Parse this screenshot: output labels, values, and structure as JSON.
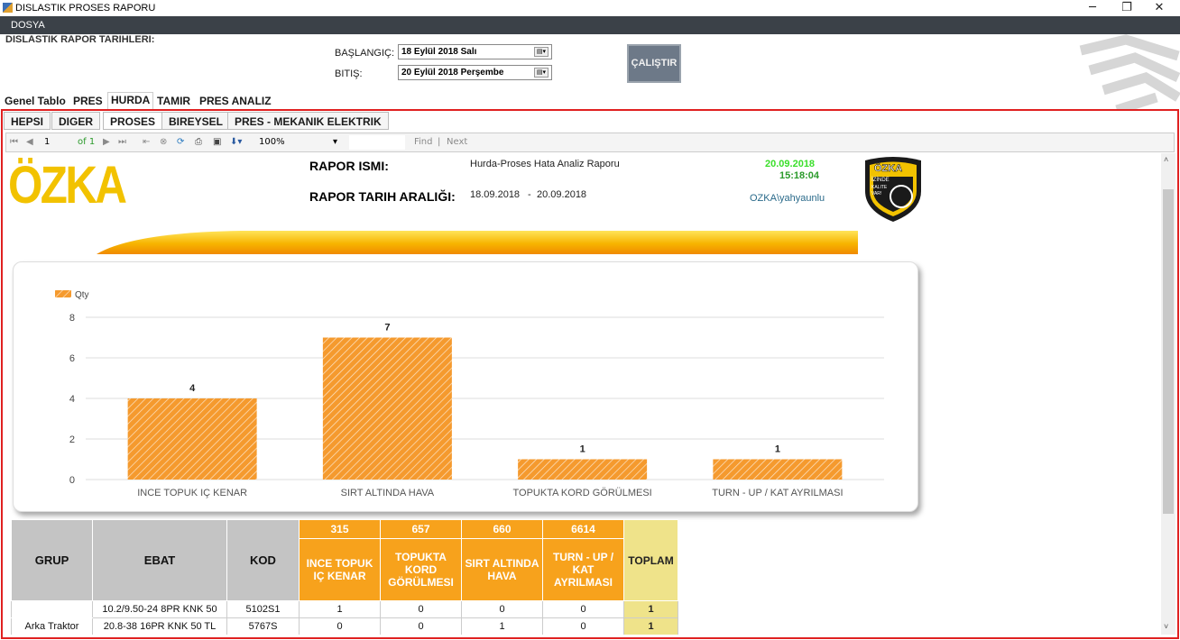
{
  "window": {
    "title": "DISLASTIK PROSES RAPORU",
    "minimize": "─",
    "restore": "❐",
    "close": "✕"
  },
  "menu": {
    "file": "DOSYA"
  },
  "params": {
    "section_label": "DISLASTIK RAPOR TARIHLERI:",
    "start_label": "BAŞLANGIÇ:",
    "start_value": "18  Eylül   2018      Salı",
    "end_label": "BITIŞ:",
    "end_value": "20  Eylül   2018 Perşembe",
    "run_label": "ÇALIŞTIR"
  },
  "tabs_main": [
    "Genel Tablo",
    "PRES",
    "HURDA",
    "TAMIR",
    "PRES ANALIZ"
  ],
  "tabs_sub": [
    "HEPSI",
    "DIGER",
    "PROSES",
    "BIREYSEL",
    "PRES - MEKANIK ELEKTRIK"
  ],
  "toolbar": {
    "page": "1",
    "of": "of 1",
    "zoom": "100%",
    "find": "Find",
    "next": "Next",
    "sep": "|"
  },
  "report": {
    "logo": "ÖZKA",
    "name_label": "RAPOR ISMI:",
    "name_value": "Hurda-Proses Hata Analiz Raporu",
    "range_label": "RAPOR TARIH ARALIĞI:",
    "range_from": "18.09.2018",
    "range_sep": "-",
    "range_to": "20.09.2018",
    "date": "20.09.2018",
    "time": "15:18:04",
    "user": "OZKA\\yahyaunlu",
    "badge_title": "ÖZKA",
    "badge_sub1": "İZİNDE",
    "badge_sub2": "KALITE",
    "badge_sub3": "VAR!"
  },
  "colors": {
    "bar": "#f59a2e",
    "accent_red": "#e02020",
    "orange_header": "#f7a21c",
    "yellow_total": "#efe38a"
  },
  "chart_data": {
    "type": "bar",
    "categories": [
      "INCE TOPUK IÇ KENAR",
      "SIRT ALTINDA HAVA",
      "TOPUKTA KORD GÖRÜLMESI",
      "TURN - UP / KAT AYRILMASI"
    ],
    "series": [
      {
        "name": "Qty",
        "values": [
          4,
          7,
          1,
          1
        ]
      }
    ],
    "ylim": [
      0,
      8
    ],
    "yticks": [
      0,
      2,
      4,
      6,
      8
    ],
    "grid": true,
    "legend": "top-left"
  },
  "table": {
    "headers": {
      "grup": "GRUP",
      "ebat": "EBAT",
      "kod": "KOD",
      "toplam": "TOPLAM"
    },
    "defects": [
      {
        "code": "315",
        "name": "INCE TOPUK IÇ KENAR"
      },
      {
        "code": "657",
        "name": "TOPUKTA KORD GÖRÜLMESI"
      },
      {
        "code": "660",
        "name": "SIRT ALTINDA HAVA"
      },
      {
        "code": "6614",
        "name": "TURN - UP / KAT AYRILMASI"
      }
    ],
    "rows": [
      {
        "grup": "",
        "ebat": "10.2/9.50-24 8PR KNK 50",
        "kod": "5102S1",
        "v": [
          "1",
          "0",
          "0",
          "0"
        ],
        "total": "1"
      },
      {
        "grup": "Arka Traktor",
        "ebat": "20.8-38 16PR KNK 50 TL",
        "kod": "5767S",
        "v": [
          "0",
          "0",
          "1",
          "0"
        ],
        "total": "1"
      }
    ]
  }
}
